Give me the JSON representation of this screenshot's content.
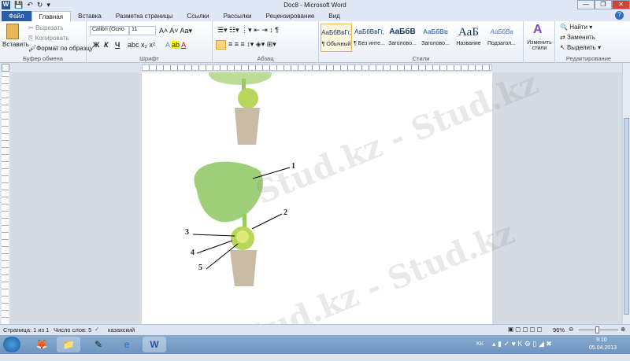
{
  "window": {
    "title": "Doc8 - Microsoft Word",
    "minimize": "—",
    "restore": "❐",
    "close": "✕"
  },
  "quick_access": [
    "W",
    "💾",
    "↶",
    "↻",
    "▾"
  ],
  "tabs": [
    "Файл",
    "Главная",
    "Вставка",
    "Разметка страницы",
    "Ссылки",
    "Рассылки",
    "Рецензирование",
    "Вид"
  ],
  "clipboard": {
    "paste": "Вставить",
    "cut": "Вырезать",
    "copy": "Копировать",
    "format_painter": "Формат по образцу",
    "label": "Буфер обмена"
  },
  "font": {
    "name": "Calibri (Осно",
    "size": "11",
    "bold": "Ж",
    "italic": "К",
    "underline": "Ч",
    "label": "Шрифт"
  },
  "paragraph": {
    "label": "Абзац"
  },
  "styles": {
    "items": [
      {
        "preview": "АаБбВвГг,",
        "name": "¶ Обычный"
      },
      {
        "preview": "АаБбВвГг,",
        "name": "¶ Без инте..."
      },
      {
        "preview": "АаБбВ",
        "name": "Заголово..."
      },
      {
        "preview": "АаБбВв",
        "name": "Заголово..."
      },
      {
        "preview": "АаБ",
        "name": "Название"
      },
      {
        "preview": "АаБбВв",
        "name": "Подзагол..."
      }
    ],
    "change": "Изменить стили",
    "label": "Стили"
  },
  "editing": {
    "find": "Найти",
    "replace": "Заменить",
    "select": "Выделить",
    "label": "Редактирование"
  },
  "figure": {
    "labels": [
      "1",
      "2",
      "3",
      "4",
      "5"
    ]
  },
  "watermark": "Stud.kz - Stud.kz",
  "status": {
    "page": "Страница: 1 из 1",
    "words": "Число слов: 5",
    "language": "казахский",
    "zoom": "96%"
  },
  "tray": {
    "lang": "KK",
    "time": "9:10",
    "date": "05.04.2013"
  }
}
